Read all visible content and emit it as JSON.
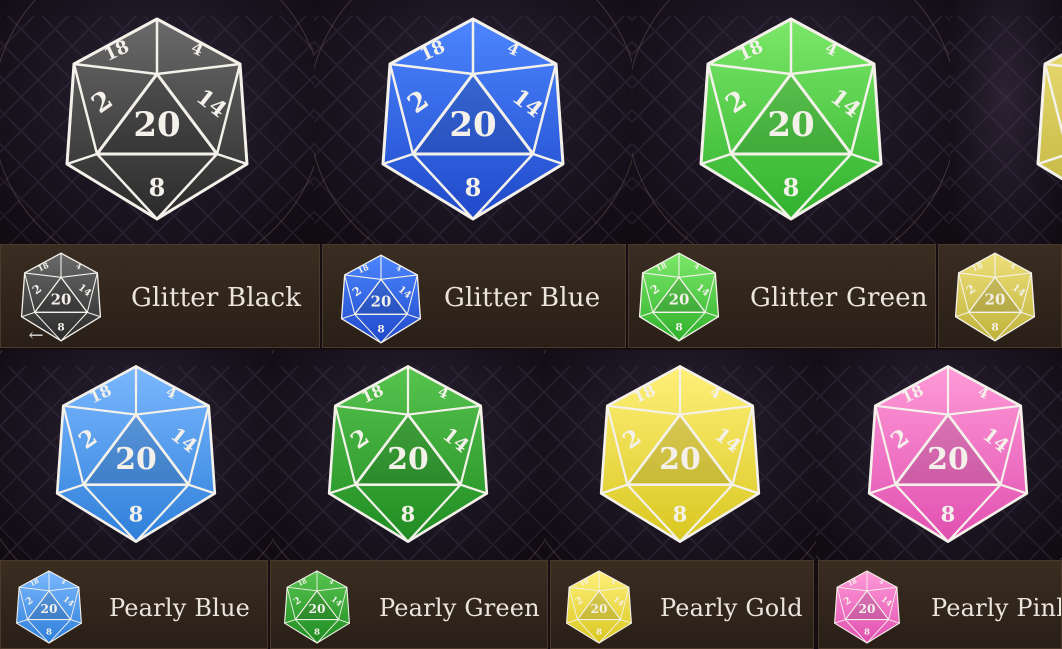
{
  "die_faces": {
    "top_left": "18",
    "top_right": "4",
    "left": "2",
    "right": "14",
    "center": "20",
    "bottom": "8"
  },
  "row1": {
    "items": [
      {
        "label": "Glitter Black",
        "color": "#2a2a2a",
        "light": "#6a6a6a",
        "icon": "d20-die-icon"
      },
      {
        "label": "Glitter Blue",
        "color": "#1f49c9",
        "light": "#4c86ff",
        "icon": "d20-die-icon"
      },
      {
        "label": "Glitter Green",
        "color": "#2fb12c",
        "light": "#7de86a",
        "icon": "d20-die-icon"
      },
      {
        "label": "",
        "color": "#bfb23a",
        "light": "#eee07a",
        "icon": "d20-die-icon"
      }
    ]
  },
  "row2": {
    "items": [
      {
        "label": "Pearly Blue",
        "color": "#2e7fd9",
        "light": "#7bb8ff",
        "icon": "d20-die-icon"
      },
      {
        "label": "Pearly Green",
        "color": "#1f8c22",
        "light": "#58c44f",
        "icon": "d20-die-icon"
      },
      {
        "label": "Pearly Gold",
        "color": "#d9c71f",
        "light": "#fff07a",
        "icon": "d20-die-icon"
      },
      {
        "label": "Pearly Pink",
        "color": "#e04fb0",
        "light": "#ff9ad8",
        "icon": "d20-die-icon"
      }
    ]
  },
  "back_icon": "arrow-left-icon"
}
